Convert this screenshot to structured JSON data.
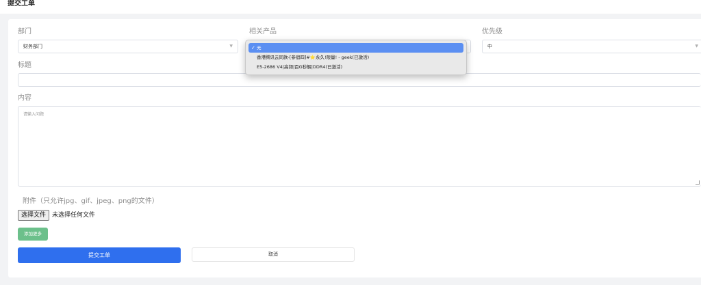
{
  "page": {
    "title": "提交工单"
  },
  "form": {
    "department": {
      "label": "部门",
      "value": "财务部门"
    },
    "product": {
      "label": "相关产品"
    },
    "priority": {
      "label": "优先级",
      "value": "中"
    },
    "subject": {
      "label": "标题",
      "value": ""
    },
    "content": {
      "label": "内容",
      "placeholder": "请输入问题"
    },
    "attachment": {
      "label": "附件（只允许jpg、gif、jpeg、png的文件）",
      "button": "选择文件",
      "status": "未选择任何文件"
    },
    "add_more_label": "添加更多",
    "submit_label": "提交工单",
    "cancel_label": "取消"
  },
  "product_dropdown": {
    "options": [
      {
        "label": "无",
        "selected": true
      },
      {
        "label": "香港腾讯云同款-[参宿四]#⭐永久!限量! - geek(已激活)",
        "selected": false
      },
      {
        "label": "E5-2686 V4|高频|百G秒解|DDR4(已激活)",
        "selected": false
      }
    ],
    "check_icon": "✓"
  },
  "colors": {
    "primary": "#2f6fee",
    "success": "#6cc08b",
    "selected_option": "#5b8ff2"
  }
}
